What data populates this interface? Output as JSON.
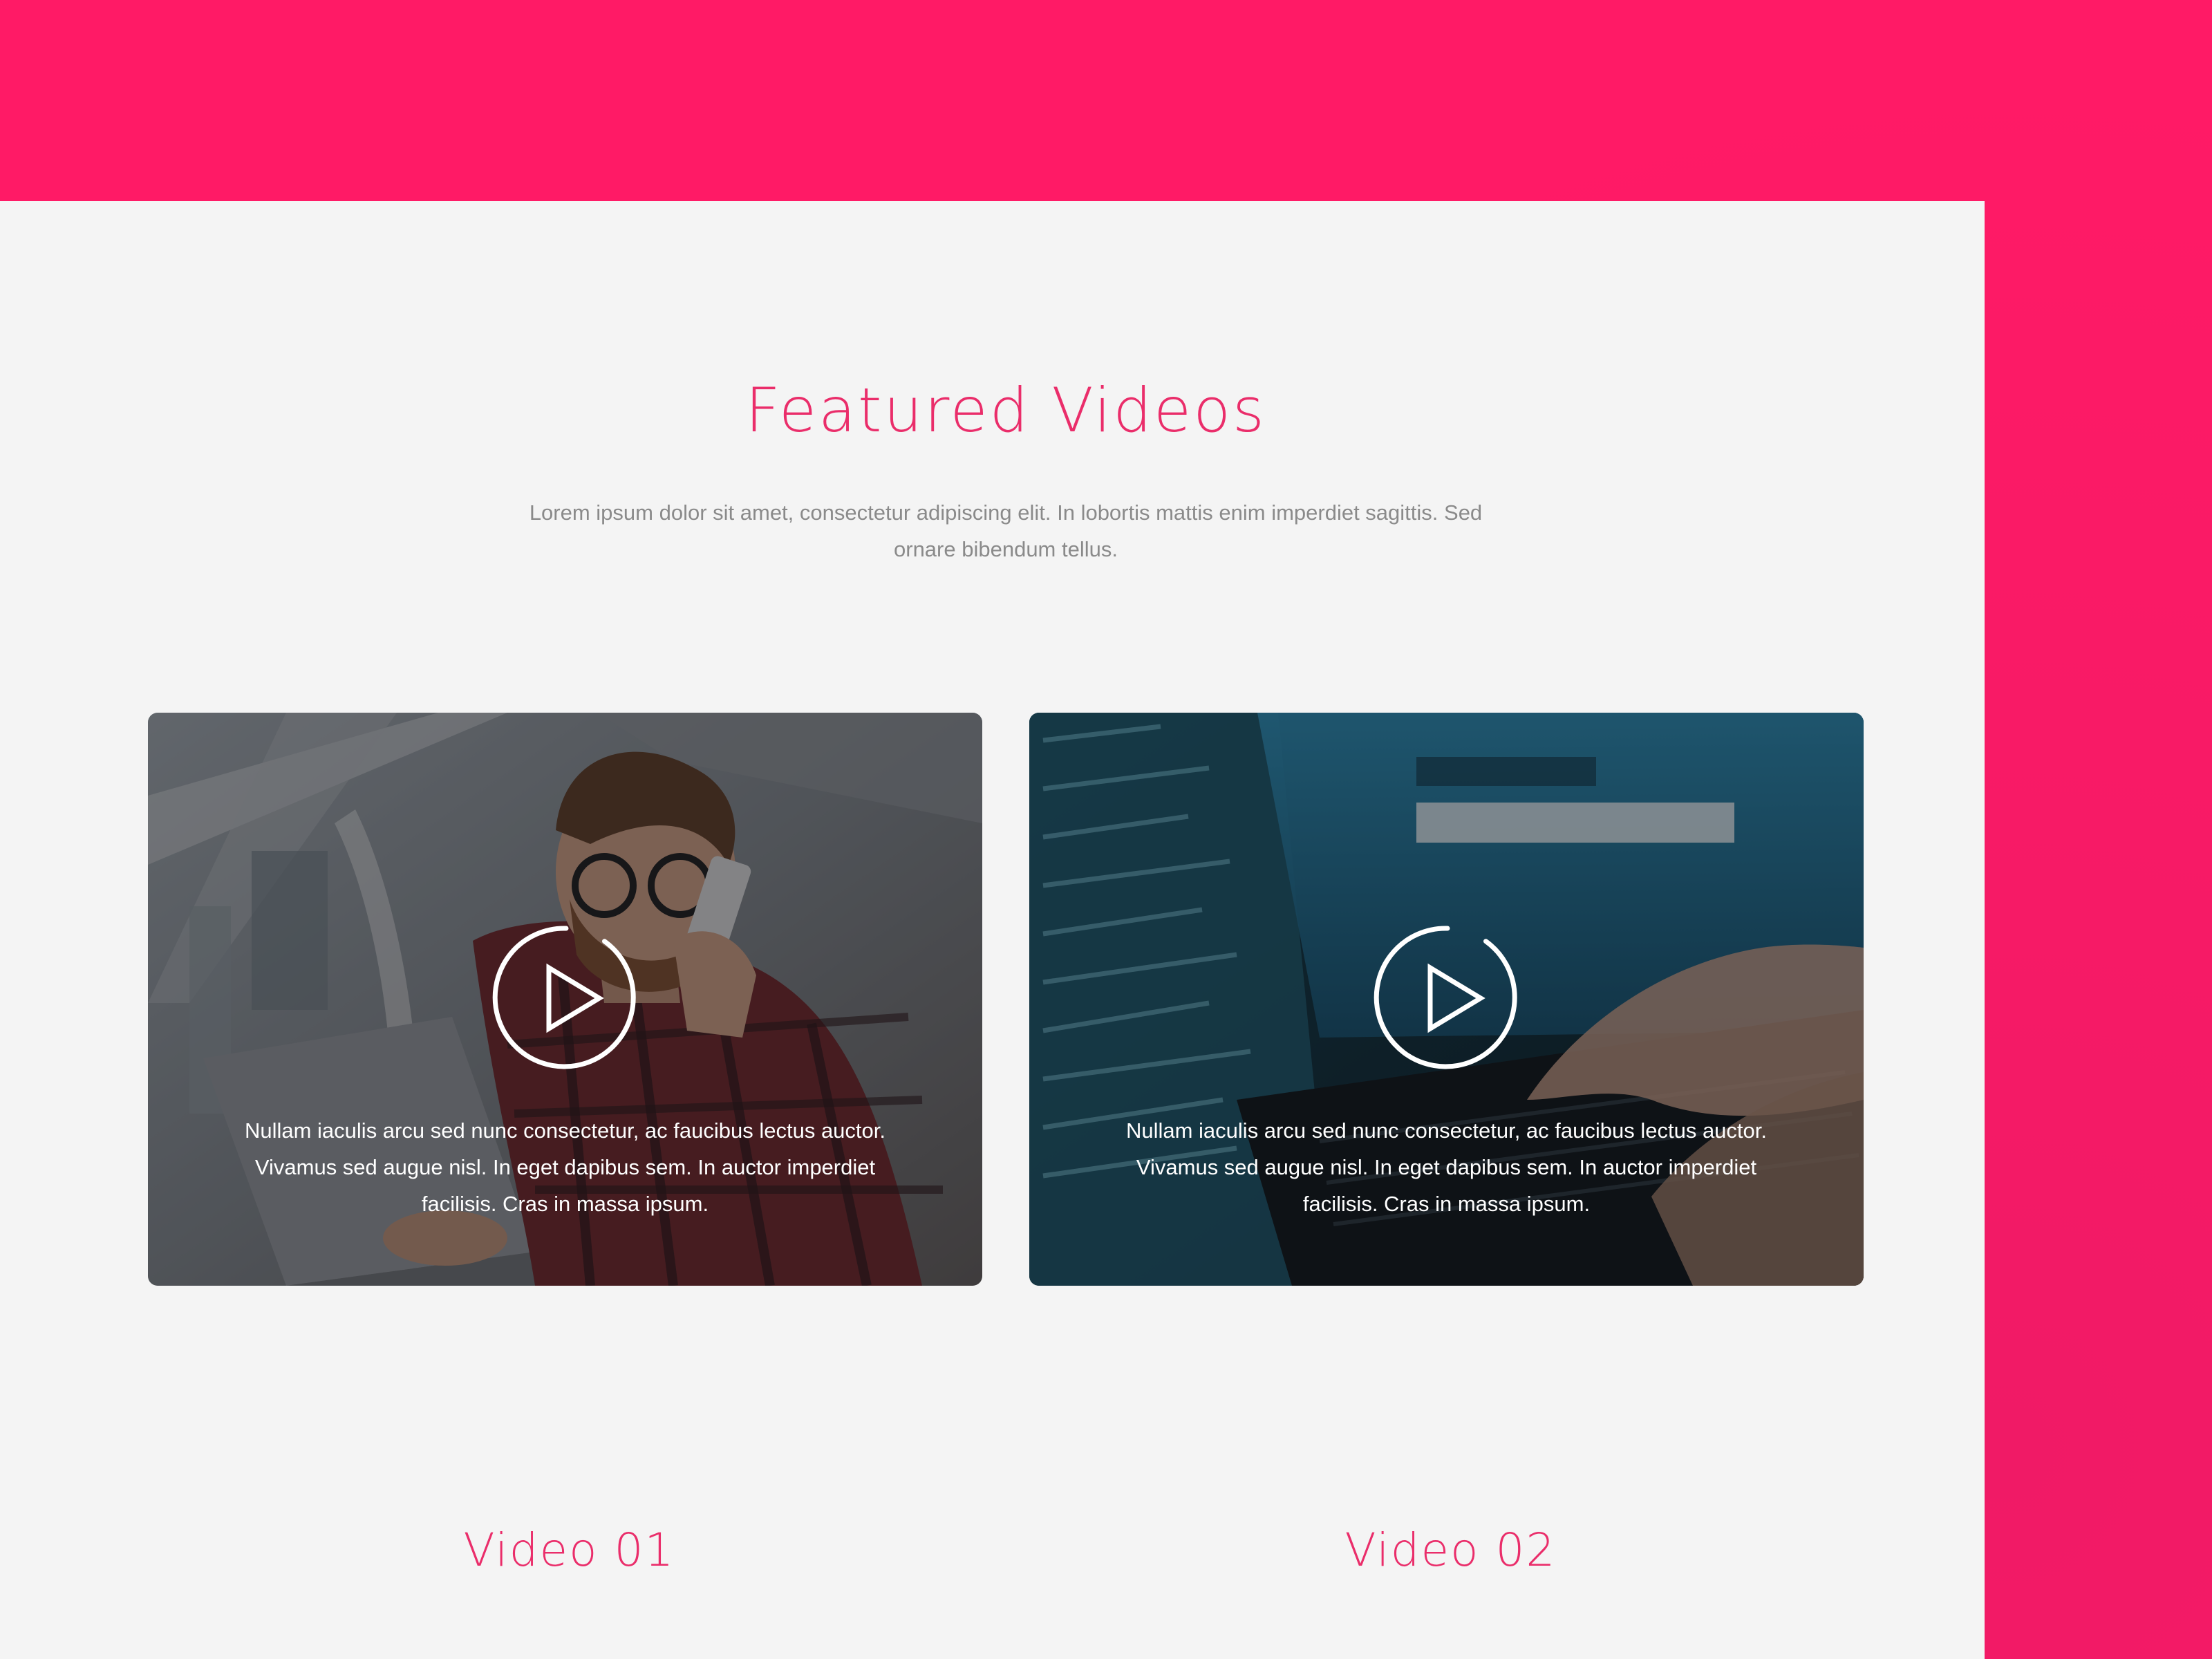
{
  "section": {
    "title": "Featured Videos",
    "subtitle": "Lorem ipsum dolor sit amet, consectetur adipiscing elit. In lobortis mattis enim imperdiet sagittis. Sed ornare bibendum tellus."
  },
  "videos": [
    {
      "label": "Video 01",
      "description": "Nullam iaculis arcu sed nunc consectetur, ac faucibus lectus auctor. Vivamus sed augue nisl. In eget dapibus sem. In auctor imperdiet facilisis. Cras in massa ipsum.",
      "thumbnail": "man-with-phone-and-laptop-image",
      "icon": "play-icon"
    },
    {
      "label": "Video 02",
      "description": "Nullam iaculis arcu sed nunc consectetur, ac faucibus lectus auctor. Vivamus sed augue nisl. In eget dapibus sem. In auctor imperdiet facilisis. Cras in massa ipsum.",
      "thumbnail": "laptop-code-password-image",
      "icon": "play-icon"
    }
  ],
  "colors": {
    "accent": "#ea2d6a",
    "background": "#ff1a66",
    "panel": "#f4f4f4",
    "body_text": "#8a8a8a"
  }
}
